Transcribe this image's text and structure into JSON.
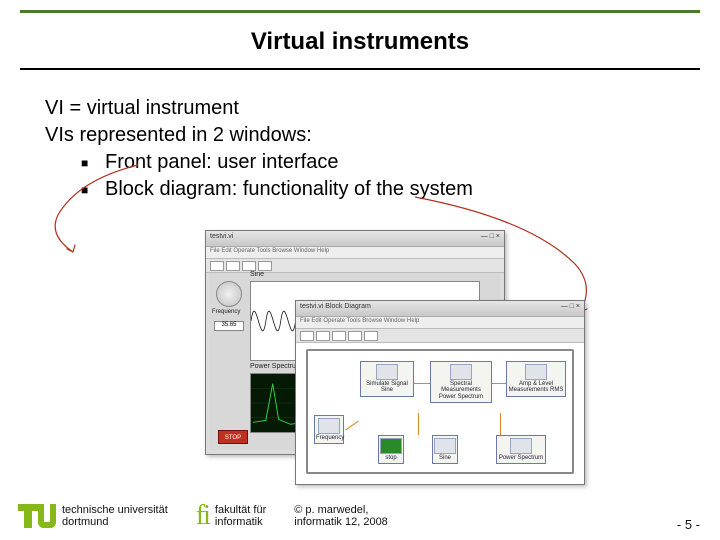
{
  "title": "Virtual instruments",
  "body": {
    "line1": "VI = virtual instrument",
    "line2": "VIs represented in 2 windows:",
    "bullets": [
      "Front panel: user interface",
      "Block diagram: functionality of the system"
    ]
  },
  "front_panel": {
    "title": "testvi.vi",
    "menu": "File  Edit  Operate  Tools  Browse  Window  Help",
    "label_sine": "Sine",
    "label_spectrum": "Power Spectrum",
    "knob_label": "Frequency",
    "knob_value": "35.65",
    "stop_label": "STOP"
  },
  "block_diagram": {
    "title": "testvi.vi  Block Diagram",
    "menu": "File  Edit  Operate  Tools  Browse  Window  Help",
    "nodes": {
      "freq": "Frequency",
      "simulate": "Simulate Signal\nSine",
      "spectral": "Spectral\nMeasurements\nPower Spectrum",
      "amplevel": "Amp & Level\nMeasurements\nRMS",
      "stop": "stop",
      "sine": "Sine",
      "out": "Power Spectrum"
    }
  },
  "footer": {
    "tu_line1": "technische universität",
    "tu_line2": "dortmund",
    "fi_line1": "fakultät für",
    "fi_line2": "informatik",
    "copy_line1": "©  p. marwedel,",
    "copy_line2": "informatik 12,  2008",
    "page": "- 5 -"
  }
}
